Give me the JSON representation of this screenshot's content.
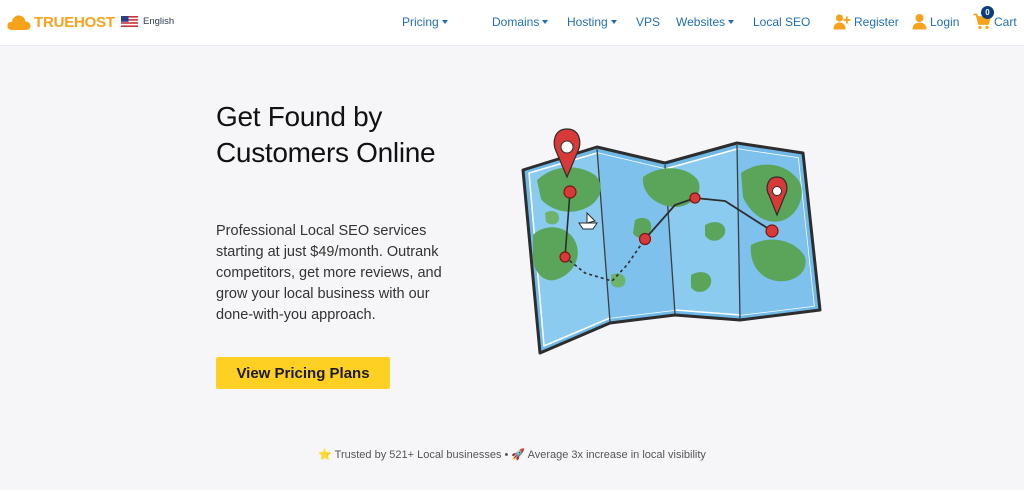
{
  "header": {
    "logo_text": "TRUEHOST",
    "language": {
      "label": "English",
      "flag": "us-flag"
    },
    "nav": [
      {
        "label": "Pricing",
        "has_dropdown": true
      },
      {
        "label": "Domains",
        "has_dropdown": true
      },
      {
        "label": "Hosting",
        "has_dropdown": true
      },
      {
        "label": "VPS",
        "has_dropdown": false
      },
      {
        "label": "Websites",
        "has_dropdown": true
      },
      {
        "label": "Local SEO",
        "has_dropdown": false
      }
    ],
    "account": {
      "register_label": "Register",
      "register_icon": "add-user-icon",
      "login_label": "Login",
      "login_icon": "user-icon",
      "cart_label": "Cart",
      "cart_icon": "cart-icon",
      "cart_count": "0"
    }
  },
  "hero": {
    "title": "Get Found by Customers Online",
    "description": "Professional Local SEO services starting at just $49/month. Outrank competitors, get more reviews, and grow your local business with our done-with-you approach.",
    "cta_label": "View Pricing Plans",
    "illustration": "folded-map-with-route-icon"
  },
  "trust_line": "⭐ Trusted by 521+ Local businesses • 🚀 Average 3x increase in local visibility",
  "colors": {
    "brand_orange": "#f7a21b",
    "nav_link_blue": "#1f6fb3",
    "cta_yellow": "#ffd024",
    "page_background": "#f6f6f8",
    "map_water": "#6fb9e8",
    "map_land": "#5aa55a",
    "pin_red": "#d83a3a"
  }
}
